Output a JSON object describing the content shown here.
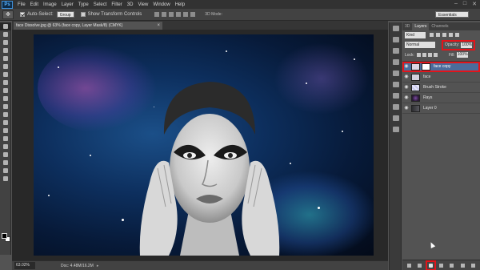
{
  "app": {
    "logo": "Ps"
  },
  "menu": [
    "File",
    "Edit",
    "Image",
    "Layer",
    "Type",
    "Select",
    "Filter",
    "3D",
    "View",
    "Window",
    "Help"
  ],
  "window_controls": [
    "–",
    "□",
    "✕"
  ],
  "options_bar": {
    "auto_select_label": "Auto-Select:",
    "auto_select_value": "Group",
    "transform_label": "Show Transform Controls",
    "three_d_label": "3D Mode:",
    "workspace": "Essentials"
  },
  "document": {
    "tab_title": "face Dissolve.jpg @ 63% (face copy, Layer Mask/8) (CMYK)",
    "close": "×",
    "zoom": "63.02%",
    "doc_info": "Doc: 4.48M/16.2M",
    "status_arrow": "▸"
  },
  "layers_panel": {
    "tabs": [
      "3D",
      "Layers",
      "Channels"
    ],
    "active_tab": "Layers",
    "kind_label": "Kind",
    "blend_mode": "Normal",
    "opacity_label": "Opacity:",
    "opacity_value": "100%",
    "lock_label": "Lock:",
    "fill_label": "Fill:",
    "fill_value": "100%",
    "layers": [
      {
        "name": "face copy",
        "selected": true,
        "has_mask": true,
        "thumb_color": "#dcd6e4"
      },
      {
        "name": "face",
        "selected": false,
        "has_mask": false,
        "thumb_color": "#d4d0dc"
      },
      {
        "name": "Brush Stroke",
        "selected": false,
        "has_mask": false,
        "thumb_color": "#d9d9f3"
      },
      {
        "name": "Rays",
        "selected": false,
        "has_mask": false,
        "thumb_color": "#2a1a36"
      },
      {
        "name": "Layer 0",
        "selected": false,
        "has_mask": false,
        "thumb_color": "#3c3c42"
      }
    ]
  },
  "colors": {
    "highlight_red": "#e3141a",
    "selected_layer": "#4b6c9c",
    "panel_bg": "#535353",
    "app_dark": "#323232"
  }
}
